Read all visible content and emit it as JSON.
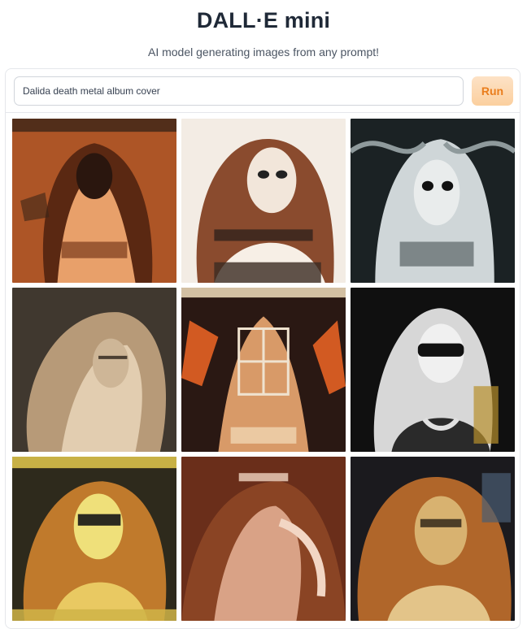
{
  "header": {
    "title": "DALL·E mini",
    "subtitle": "AI model generating images from any prompt!"
  },
  "prompt": {
    "value": "Dalida death metal album cover"
  },
  "run_button": {
    "label": "Run"
  },
  "colors": {
    "run_bg": "#fbcf9e",
    "run_text": "#ea7d1c",
    "panel_border": "#e5e7eb"
  },
  "gallery": {
    "images": [
      {
        "name": "generated-image-1",
        "tone": "orange"
      },
      {
        "name": "generated-image-2",
        "tone": "warm-bw"
      },
      {
        "name": "generated-image-3",
        "tone": "bw"
      },
      {
        "name": "generated-image-4",
        "tone": "sepia"
      },
      {
        "name": "generated-image-5",
        "tone": "orange-dark"
      },
      {
        "name": "generated-image-6",
        "tone": "bw-gold"
      },
      {
        "name": "generated-image-7",
        "tone": "yellow"
      },
      {
        "name": "generated-image-8",
        "tone": "brown"
      },
      {
        "name": "generated-image-9",
        "tone": "gold"
      }
    ]
  }
}
